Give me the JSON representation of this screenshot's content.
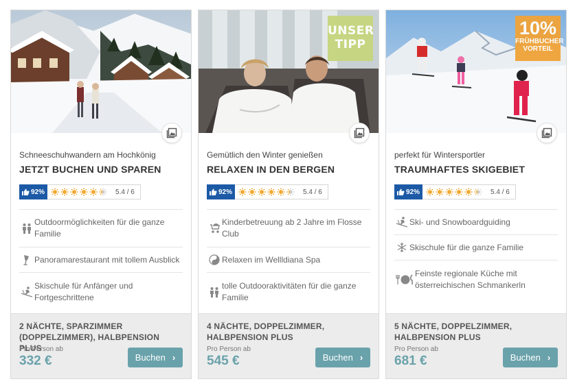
{
  "rating": {
    "percent": "92%",
    "suns_filled": 5.4,
    "suns_total": 6,
    "score": "5.4 / 6"
  },
  "price_label": "Pro Person ab",
  "book_label": "Buchen",
  "colors": {
    "accent": "#6aa2ab",
    "rating_blue": "#1c5aa6",
    "sun": "#f5a623",
    "tipp_badge": "#c6d67d",
    "pct_badge": "#f0a43a"
  },
  "cards": [
    {
      "subtitle": "Schneeschuhwandern am Hochkönig",
      "title": "JETZT BUCHEN UND SPAREN",
      "features": [
        {
          "icon": "family-icon",
          "text": "Outdoormöglichkeiten für die ganze Familie"
        },
        {
          "icon": "wine-glass-icon",
          "text": "Panoramarestaurant mit tollem Ausblick"
        },
        {
          "icon": "skier-icon",
          "text": "Skischule für Anfänger und Fortgeschrittene"
        }
      ],
      "offer": "2 NÄCHTE, SPARZIMMER (DOPPELZIMMER), HALBPENSION PLUS",
      "price": "332 €"
    },
    {
      "subtitle": "Gemütlich den Winter genießen",
      "title": "RELAXEN IN DEN BERGEN",
      "badge": {
        "line1": "UNSER",
        "line2": "TIPP"
      },
      "features": [
        {
          "icon": "stroller-icon",
          "text": "Kinderbetreuung ab 2 Jahre im Flosse Club"
        },
        {
          "icon": "yin-yang-icon",
          "text": "Relaxen im Wellldiana Spa"
        },
        {
          "icon": "family-icon",
          "text": "tolle Outdooraktivitäten für die ganze Familie"
        }
      ],
      "offer": "4 NÄCHTE, DOPPELZIMMER, HALBPENSION PLUS",
      "price": "545 €"
    },
    {
      "subtitle": "perfekt für Wintersportler",
      "title": "TRAUMHAFTES SKIGEBIET",
      "badge": {
        "pct": "10%",
        "line1": "FRÜHBUCHER",
        "line2": "VORTEIL"
      },
      "features": [
        {
          "icon": "skier-icon",
          "text": "Ski- und Snowboardguiding"
        },
        {
          "icon": "snowflake-icon",
          "text": "Skischule für die ganze Familie"
        },
        {
          "icon": "cutlery-icon",
          "text": "Feinste regionale Küche mit österreichischen Schmankerln"
        }
      ],
      "offer": "5 NÄCHTE, DOPPELZIMMER, HALBPENSION PLUS",
      "price": "681 €"
    }
  ]
}
